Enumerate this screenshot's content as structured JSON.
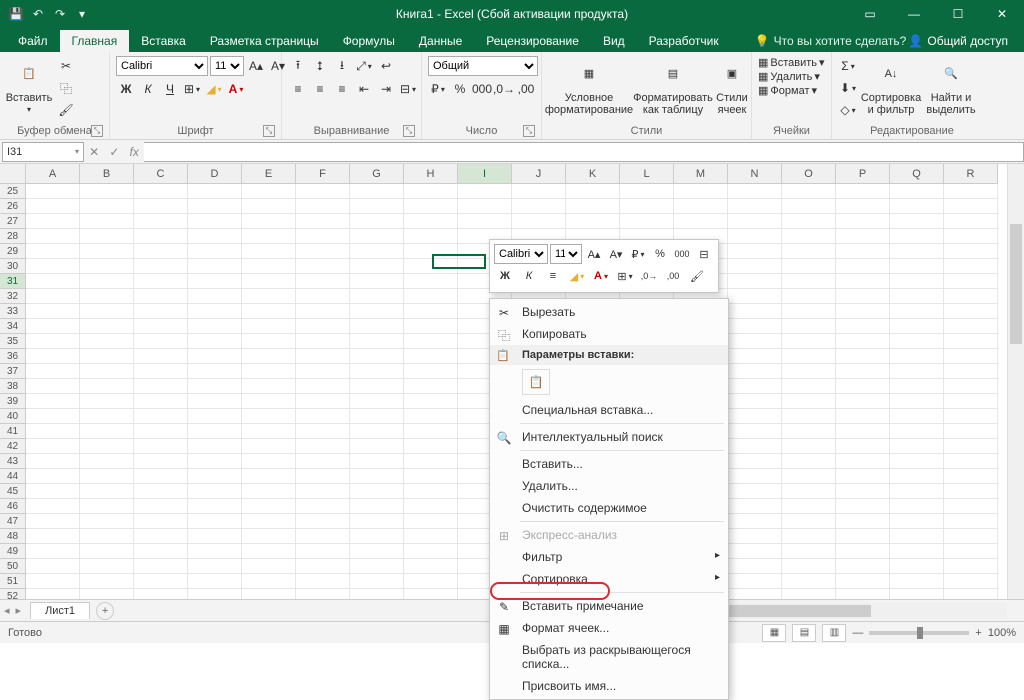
{
  "title": "Книга1 - Excel (Сбой активации продукта)",
  "tabs": [
    "Файл",
    "Главная",
    "Вставка",
    "Разметка страницы",
    "Формулы",
    "Данные",
    "Рецензирование",
    "Вид",
    "Разработчик"
  ],
  "active_tab": 1,
  "tell_me": "Что вы хотите сделать?",
  "share": "Общий доступ",
  "clipboard": {
    "paste": "Вставить",
    "label": "Буфер обмена"
  },
  "font": {
    "name": "Calibri",
    "size": "11",
    "label": "Шрифт"
  },
  "alignment": {
    "label": "Выравнивание"
  },
  "number": {
    "format": "Общий",
    "label": "Число"
  },
  "styles": {
    "cond": "Условное форматирование",
    "table": "Форматировать как таблицу",
    "cell": "Стили ячеек",
    "label": "Стили"
  },
  "cells": {
    "insert": "Вставить",
    "delete": "Удалить",
    "format": "Формат",
    "label": "Ячейки"
  },
  "editing": {
    "sort": "Сортировка и фильтр",
    "find": "Найти и выделить",
    "label": "Редактирование"
  },
  "namebox": "I31",
  "columns": [
    "A",
    "B",
    "C",
    "D",
    "E",
    "F",
    "G",
    "H",
    "I",
    "J",
    "K",
    "L",
    "M",
    "N",
    "O",
    "P",
    "Q",
    "R"
  ],
  "active_col": 8,
  "rows_start": 25,
  "rows_end": 52,
  "active_row": 31,
  "sheet": "Лист1",
  "status": "Готово",
  "zoom": "100%",
  "mini": {
    "font": "Calibri",
    "size": "11"
  },
  "ctx": {
    "cut": "Вырезать",
    "copy": "Копировать",
    "paste_header": "Параметры вставки:",
    "paste_special": "Специальная вставка...",
    "smart_lookup": "Интеллектуальный поиск",
    "insert": "Вставить...",
    "delete": "Удалить...",
    "clear": "Очистить содержимое",
    "quick": "Экспресс-анализ",
    "filter": "Фильтр",
    "sort": "Сортировка",
    "comment": "Вставить примечание",
    "format_cells": "Формат ячеек...",
    "dropdown": "Выбрать из раскрывающегося списка...",
    "name": "Присвоить имя..."
  }
}
